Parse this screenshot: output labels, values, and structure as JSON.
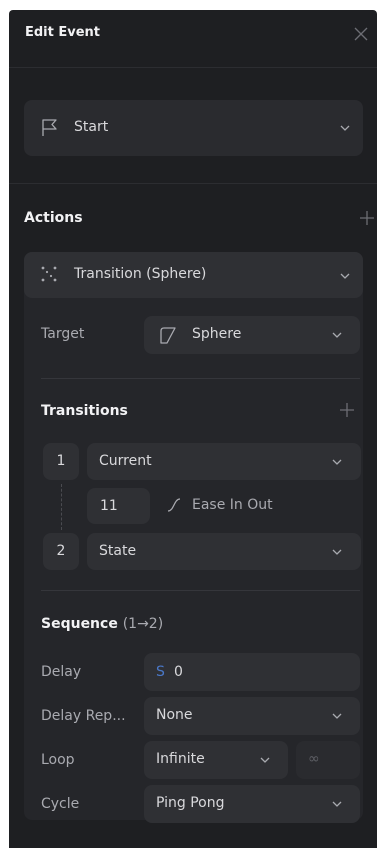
{
  "header": {
    "title": "Edit Event"
  },
  "trigger": {
    "label": "Start"
  },
  "actions": {
    "title": "Actions",
    "action_label": "Transition (Sphere)",
    "target_label": "Target",
    "target_value": "Sphere"
  },
  "transitions": {
    "title": "Transitions",
    "items": [
      {
        "num": "1",
        "value": "Current"
      },
      {
        "num": "2",
        "value": "State"
      }
    ],
    "duration": "11",
    "easing": "Ease In Out"
  },
  "sequence": {
    "title": "Sequence",
    "range": "(1→2)",
    "delay_label": "Delay",
    "delay_unit": "S",
    "delay_value": "0",
    "delay_repeat_label": "Delay Rep...",
    "delay_repeat_value": "None",
    "loop_label": "Loop",
    "loop_value": "Infinite",
    "loop_count_placeholder": "∞",
    "cycle_label": "Cycle",
    "cycle_value": "Ping Pong"
  },
  "colors": {
    "panel": "#1e1f22",
    "field": "#2a2b2f",
    "accent": "#4a78c8"
  }
}
